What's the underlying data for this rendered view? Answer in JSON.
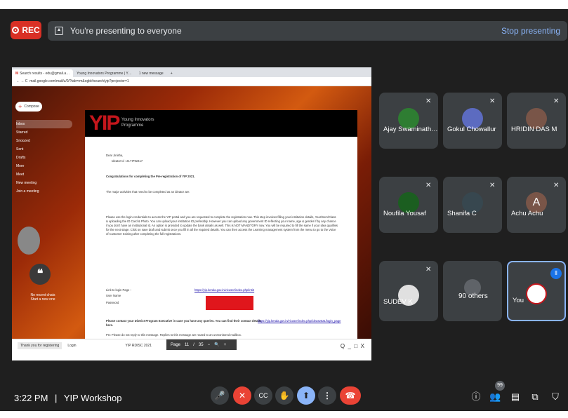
{
  "record": {
    "label": "REC"
  },
  "presenting": {
    "message": "You're presenting to everyone",
    "stop_label": "Stop presenting"
  },
  "shared_screen": {
    "tabs": [
      "Search results - edu@gmail.a…",
      "Young Innovators Programme | Y…",
      "1 new message"
    ],
    "url": "mail.google.com/mail/u/0/?tab=rm&ogbl#search/yip?projector=1",
    "gmail": {
      "compose_label": "Compose",
      "nav": [
        "Inbox",
        "Starred",
        "Snoozed",
        "Sent",
        "Drafts",
        "More"
      ],
      "meet_label": "Meet",
      "meet_items": [
        "New meeting",
        "Join a meeting"
      ],
      "no_chats": "No recent chats",
      "start_chat": "Start a new one"
    },
    "email": {
      "logo": "YIP",
      "org_line1": "Young Innovators",
      "org_line2": "Programme",
      "salutation": "Dear Jinisha,",
      "ideator_id": "Ideator Id : 21YIP02417",
      "congrats": "Congratulations for completing the Pre-registration of YIP 2021.",
      "activities": "The major activities that need to be completed as an ideator are:",
      "body": "Please use the login credentials to access the YIP portal and you are requested to complete the registration now. This step involves filling your institution details, Year/Sem/Class & uploading the ID Card & Photo. You can upload your institution ID preferably. However you can upload any government ID reflecting your name, age & gender if by any chance if you don't have an institutional Id. An option is provided to update the bank details as well. This is NOT MANDTORY now. You will be required to fill the same if your idea qualifies for the next stage. Click on save draft and submit once you fill in all the required details. You can then access the Learning management system from the menu to go to the Voice of Customer training after completing the full registrations.",
      "login_label": "Link to login Page :",
      "login_link": "https://yip.kerala.gov.in/vicuser/index.php/inti2",
      "username_label": "User Name",
      "password_label": "Password",
      "contact": "Please contact your District Program Executive in case you have any queries. You can find their contact details here.",
      "contact_link": "https://yip.kerala.gov.in/vicuser/index.php/ideas2021/login_page",
      "ps": "PS: Please do not reply to this message. Replies to this message are routed to an unmonitored mailbox."
    },
    "bottom_tabs": [
      "Thank you for registering",
      "Login",
      "YIP RDISC 2021"
    ],
    "pdf": {
      "page_label": "Page",
      "page": "11",
      "total": "35"
    }
  },
  "participants": [
    {
      "name": "Ajay Swaminath…",
      "muted": true
    },
    {
      "name": "Gokul Chowallur",
      "muted": true
    },
    {
      "name": "HRIDIN DAS M",
      "muted": true
    },
    {
      "name": "Noufila Yousaf",
      "muted": true
    },
    {
      "name": "Shanifa C",
      "muted": true
    },
    {
      "name": "Achu Achu",
      "muted": true,
      "initial": "A"
    },
    {
      "name": "SUDEV K",
      "muted": true
    },
    {
      "name": "90 others"
    },
    {
      "name": "You"
    }
  ],
  "footer": {
    "time": "3:22 PM",
    "separator": "|",
    "meeting": "YIP Workshop",
    "people_count": "99"
  },
  "colors": {
    "accent": "#8ab4f8",
    "danger": "#ea4335",
    "tile": "#3c4043",
    "background": "#1f1f1f"
  }
}
